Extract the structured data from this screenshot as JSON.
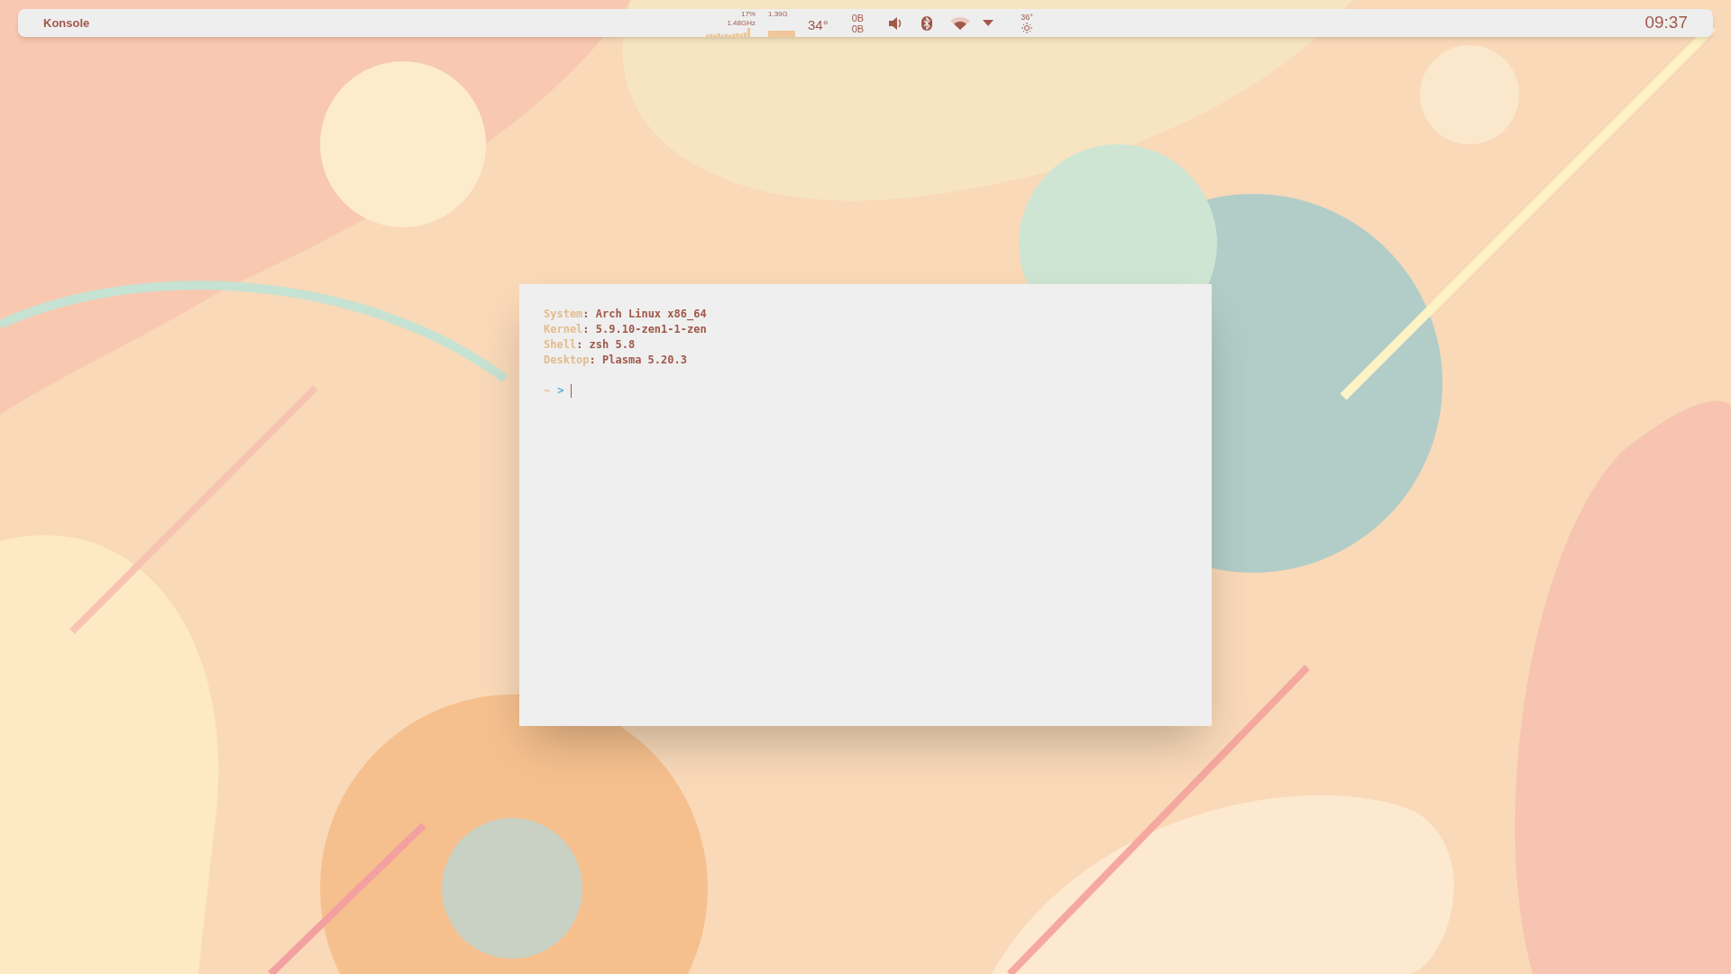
{
  "panel": {
    "app_title": "Konsole",
    "cpu": {
      "usage": "17%",
      "frequency": "1.48GHz"
    },
    "memory": "1.39G",
    "cpu_temp": "34°",
    "network": {
      "upload": "0B",
      "download": "0B"
    },
    "weather": "36°",
    "clock": "09:37"
  },
  "terminal": {
    "lines": [
      {
        "label": "System",
        "separator": ":",
        "value": "Arch Linux x86_64"
      },
      {
        "label": "Kernel",
        "separator": ":",
        "value": "5.9.10-zen1-1-zen"
      },
      {
        "label": "Shell",
        "separator": ":",
        "value": "zsh 5.8"
      },
      {
        "label": "Desktop",
        "separator": ":",
        "value": "Plasma 5.20.3"
      }
    ],
    "prompt": {
      "tilde": "~",
      "arrow": ">"
    }
  }
}
